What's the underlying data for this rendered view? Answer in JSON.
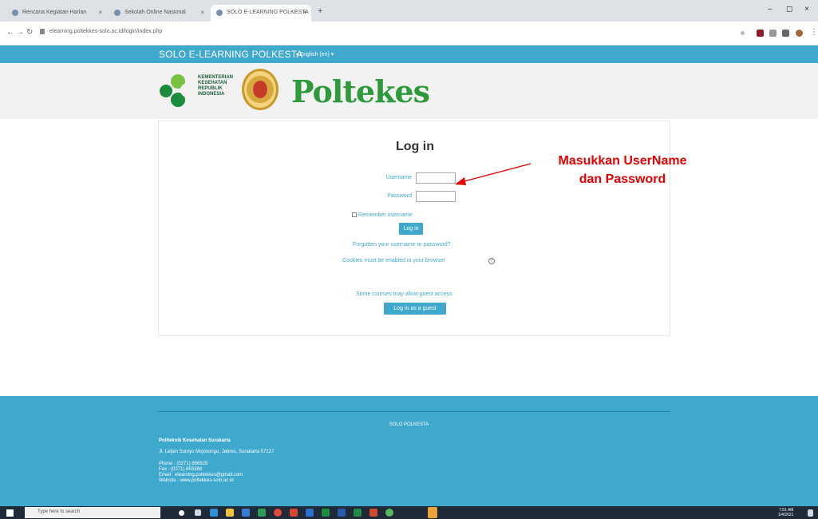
{
  "browser": {
    "tabs": [
      {
        "label": "Rencana Kegiatan Harian"
      },
      {
        "label": "Sekolah Online Nasional"
      },
      {
        "label": "SOLO E-LEARNING POLKESTA"
      }
    ],
    "url": "elearning.poltekkes-solo.ac.id/login/index.php",
    "new_tab": "+",
    "win_min": "–",
    "win_max": "◻",
    "win_close": "×"
  },
  "site": {
    "name": "SOLO E-LEARNING POLKESTA",
    "language": "English (en)",
    "logo_kemenkes": [
      "KEMENTERIAN",
      "KESEHATAN",
      "REPUBLIK",
      "INDONESIA"
    ],
    "logo_poltekes": "Poltekes"
  },
  "login": {
    "title": "Log in",
    "username_label": "Username",
    "password_label": "Password",
    "username_value": "",
    "password_value": "",
    "remember_label": "Remember username",
    "login_button": "Log in",
    "forgot_link": "Forgotten your username or password?",
    "cookies_text": "Cookies must be enabled in your browser",
    "guest_text": "Some courses may allow guest access",
    "guest_button": "Log in as a guest"
  },
  "annotation": {
    "line1": "Masukkan UserName",
    "line2": "dan Password",
    "color": "#e40000"
  },
  "footer": {
    "title": "SOLO POLKESTA",
    "org": "Politeknik Kesehatan Surakarta",
    "address": "Jl. Letjen Sutoyo Mojosongo, Jebres, Surakarta 57127",
    "phone": "Phone : (0271) 856929",
    "fax": "Fax : (0271) 855388",
    "email": "Email : elearning.poltekkes@gmail.com",
    "website": "Website : www.poltekkes-solo.ac.id"
  },
  "taskbar": {
    "search_placeholder": "Type here to search",
    "time": "7:51 AM",
    "date": "1/4/2021"
  },
  "colors": {
    "accent": "#3fa9cd",
    "footer_line": "#2b7fa0",
    "annotation": "#e40000"
  }
}
